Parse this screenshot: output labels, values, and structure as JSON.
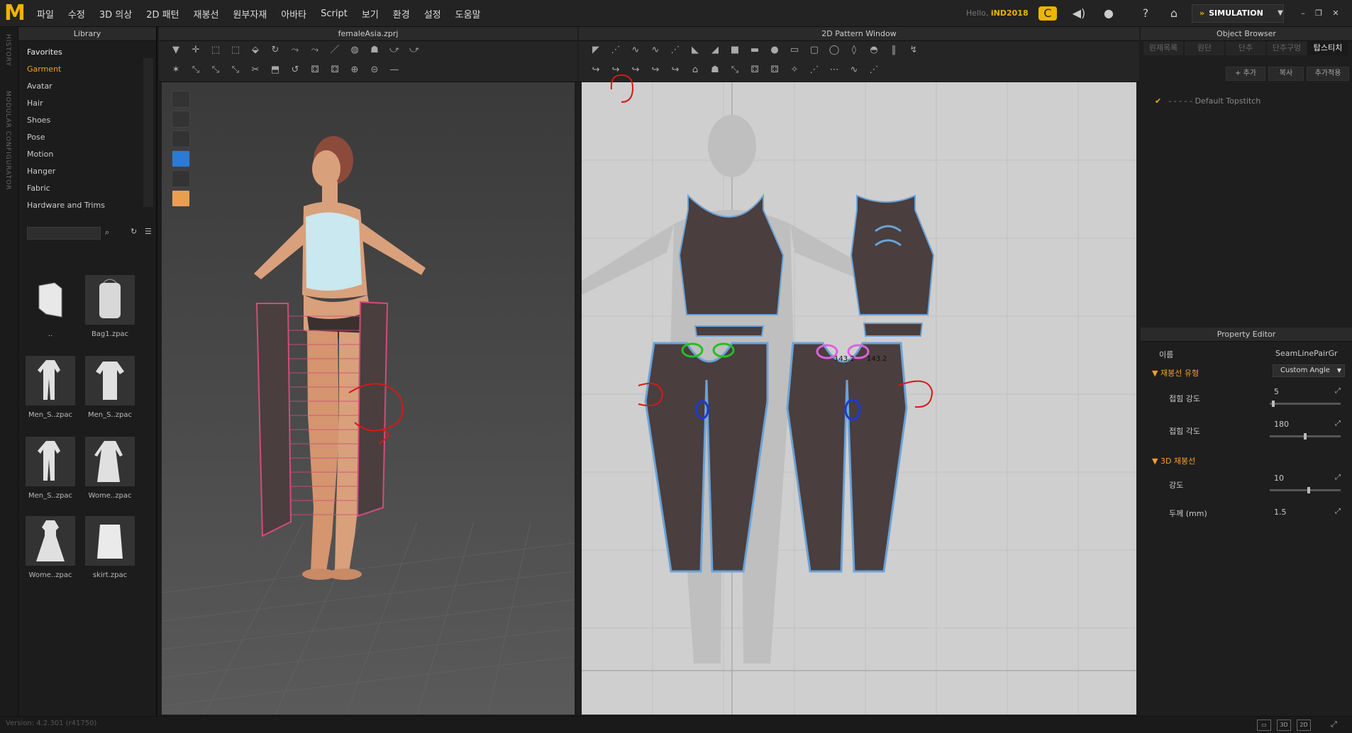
{
  "app": {
    "logo": "M"
  },
  "menu": [
    "파일",
    "수정",
    "3D 의상",
    "2D 패턴",
    "재봉선",
    "원부자재",
    "아바타",
    "Script",
    "보기",
    "환경",
    "설정",
    "도움말"
  ],
  "header": {
    "hello_prefix": "Hello,",
    "user": "iND2018",
    "simulation": "SIMULATION"
  },
  "side_strip": {
    "history": "HISTORY",
    "modular": "MODULAR CONFIGURATOR"
  },
  "library": {
    "title": "Library",
    "favorites": "Favorites",
    "items": [
      "Garment",
      "Avatar",
      "Hair",
      "Shoes",
      "Pose",
      "Motion",
      "Hanger",
      "Fabric",
      "Hardware and Trims"
    ],
    "files": [
      "..",
      "Bag1.zpac",
      "Men_S..zpac",
      "Men_S..zpac",
      "Men_S..zpac",
      "Wome..zpac",
      "Wome..zpac",
      "skirt.zpac"
    ]
  },
  "view3d": {
    "title": "femaleAsia.zprj"
  },
  "view2d": {
    "title": "2D Pattern Window",
    "measure_left": "143.2",
    "measure_right": "143.2"
  },
  "object_browser": {
    "title": "Object Browser",
    "tabs": [
      "원제목록",
      "원단",
      "단추",
      "단추구멍",
      "탑스티치"
    ],
    "add": "+ 추가",
    "copy": "복사",
    "add_applied": "추가적용",
    "default_topstitch": "Default Topstitch"
  },
  "property_editor": {
    "title": "Property Editor",
    "name_label": "이름",
    "name_value": "SeamLinePairGr",
    "section_type": "재봉선 유형",
    "type_value": "Custom Angle",
    "fold_strength_label": "접힘 강도",
    "fold_strength_value": "5",
    "fold_angle_label": "접힘 각도",
    "fold_angle_value": "180",
    "section_3d": "3D 재봉선",
    "strength_label": "강도",
    "strength_value": "10",
    "thickness_label": "두께 (mm)",
    "thickness_value": "1.5",
    "sliders": {
      "fold_strength": 0.05,
      "fold_angle": 0.5,
      "strength": 0.55
    }
  },
  "status": {
    "version": "Version: 4.2.301 (r41750)",
    "btn_3d": "3D",
    "btn_2d": "2D"
  },
  "colors": {
    "accent": "#f0b400",
    "pattern": "#4a3e3e",
    "seam_blue": "#6aa3d8",
    "annotation_red": "#d81818"
  }
}
